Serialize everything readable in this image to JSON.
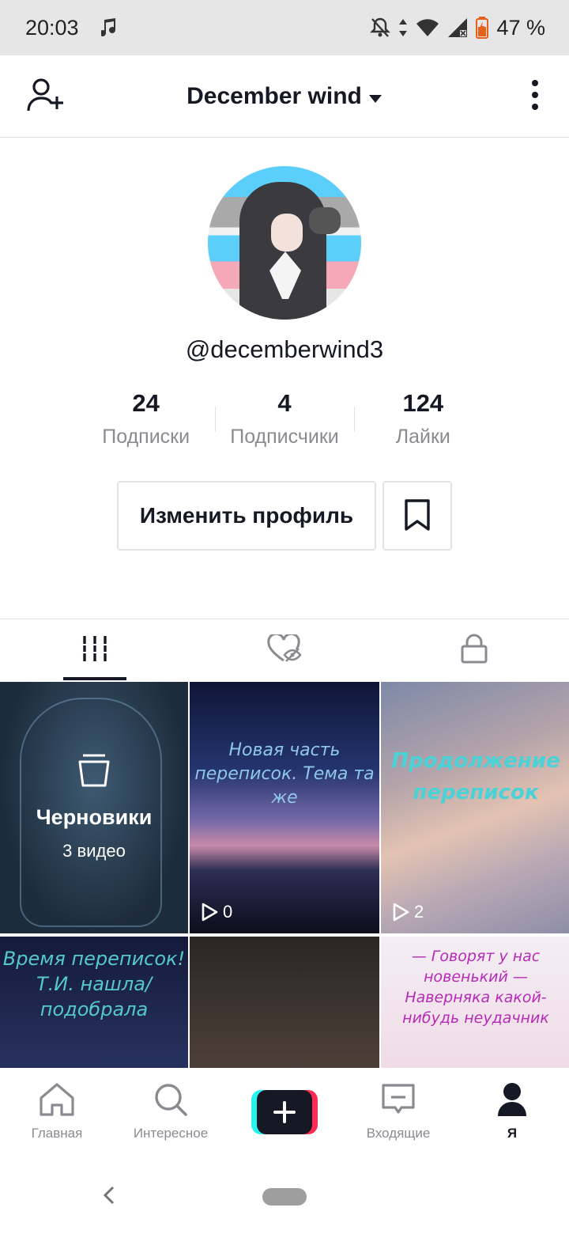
{
  "status_bar": {
    "time": "20:03",
    "battery_percent": "47 %",
    "icons": [
      "music-note-icon",
      "mute-icon",
      "data-arrows-icon",
      "wifi-icon",
      "signal-icon",
      "battery-icon"
    ]
  },
  "header": {
    "title": "December wind",
    "icons": [
      "add-user-icon",
      "dropdown-caret-icon",
      "more-icon"
    ]
  },
  "profile": {
    "username": "@decemberwind3",
    "stats": [
      {
        "value": "24",
        "label": "Подписки"
      },
      {
        "value": "4",
        "label": "Подписчики"
      },
      {
        "value": "124",
        "label": "Лайки"
      }
    ],
    "edit_button_label": "Изменить профиль"
  },
  "tabs": [
    {
      "icon": "grid-icon",
      "active": true
    },
    {
      "icon": "liked-hidden-icon",
      "active": false
    },
    {
      "icon": "lock-icon",
      "active": false
    }
  ],
  "grid": {
    "drafts": {
      "title": "Черновики",
      "count": "3 видео"
    },
    "videos": [
      {
        "text": "Новая часть переписок. Тема та же",
        "plays": "0"
      },
      {
        "text": "Продолжение переписок",
        "plays": "2"
      },
      {
        "text": "Время переписок! Т.И. нашла/ подобрала"
      },
      {
        "text": ""
      },
      {
        "text": "— Говорят у нас новенький — Наверняка какой-нибудь неудачник"
      }
    ]
  },
  "bottom_nav": [
    {
      "label": "Главная",
      "icon": "home-icon"
    },
    {
      "label": "Интересное",
      "icon": "search-icon"
    },
    {
      "label": "",
      "icon": "create-icon"
    },
    {
      "label": "Входящие",
      "icon": "inbox-icon"
    },
    {
      "label": "Я",
      "icon": "profile-icon",
      "active": true
    }
  ],
  "colors": {
    "text_primary": "#161823",
    "text_secondary": "#8a8b91",
    "border": "#e3e3e4",
    "accent_cyan": "#25f4ee",
    "accent_red": "#fe2c55"
  }
}
